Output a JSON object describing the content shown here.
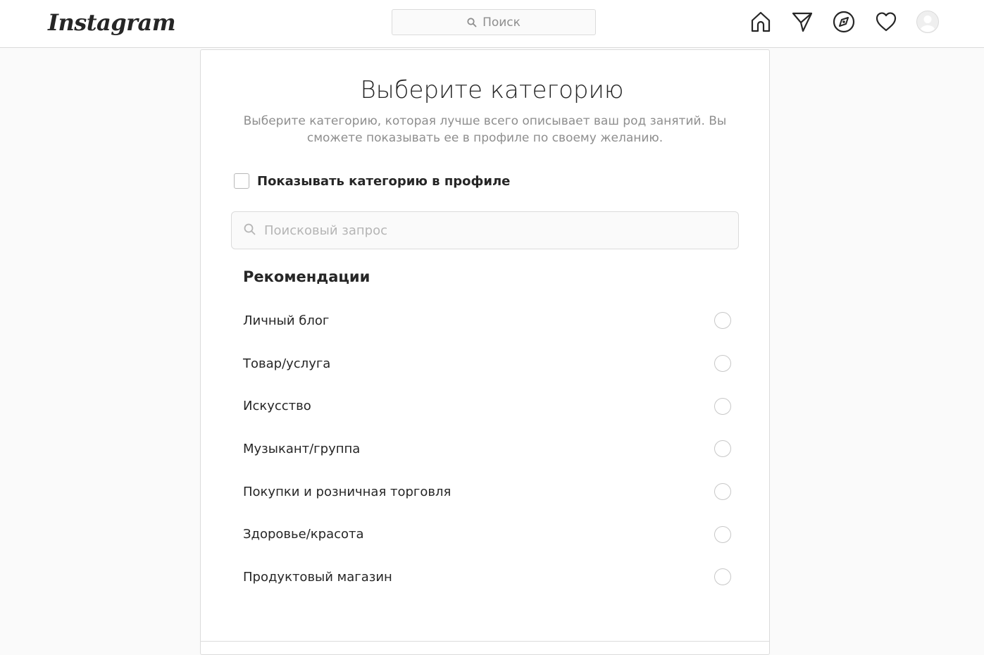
{
  "header": {
    "logo_text": "Instagram",
    "search_placeholder": "Поиск",
    "nav_icons": [
      "home-icon",
      "direct-icon",
      "explore-icon",
      "activity-icon",
      "profile-avatar"
    ]
  },
  "page": {
    "title": "Выберите категорию",
    "subtitle": "Выберите категорию, которая лучше всего описывает ваш род занятий. Вы сможете показывать ее в профиле по своему желанию.",
    "show_category_label": "Показывать категорию в профиле",
    "show_category_checked": false,
    "search_placeholder": "Поисковый запрос",
    "recommendations_heading": "Рекомендации",
    "categories": [
      {
        "label": "Личный блог",
        "selected": false
      },
      {
        "label": "Товар/услуга",
        "selected": false
      },
      {
        "label": "Искусство",
        "selected": false
      },
      {
        "label": "Музыкант/группа",
        "selected": false
      },
      {
        "label": "Покупки и розничная торговля",
        "selected": false
      },
      {
        "label": "Здоровье/красота",
        "selected": false
      },
      {
        "label": "Продуктовый магазин",
        "selected": false
      }
    ]
  },
  "colors": {
    "background": "#fafafa",
    "card": "#ffffff",
    "border": "#dbdbdb",
    "text_primary": "#262626",
    "text_secondary": "#8e8e8e"
  }
}
